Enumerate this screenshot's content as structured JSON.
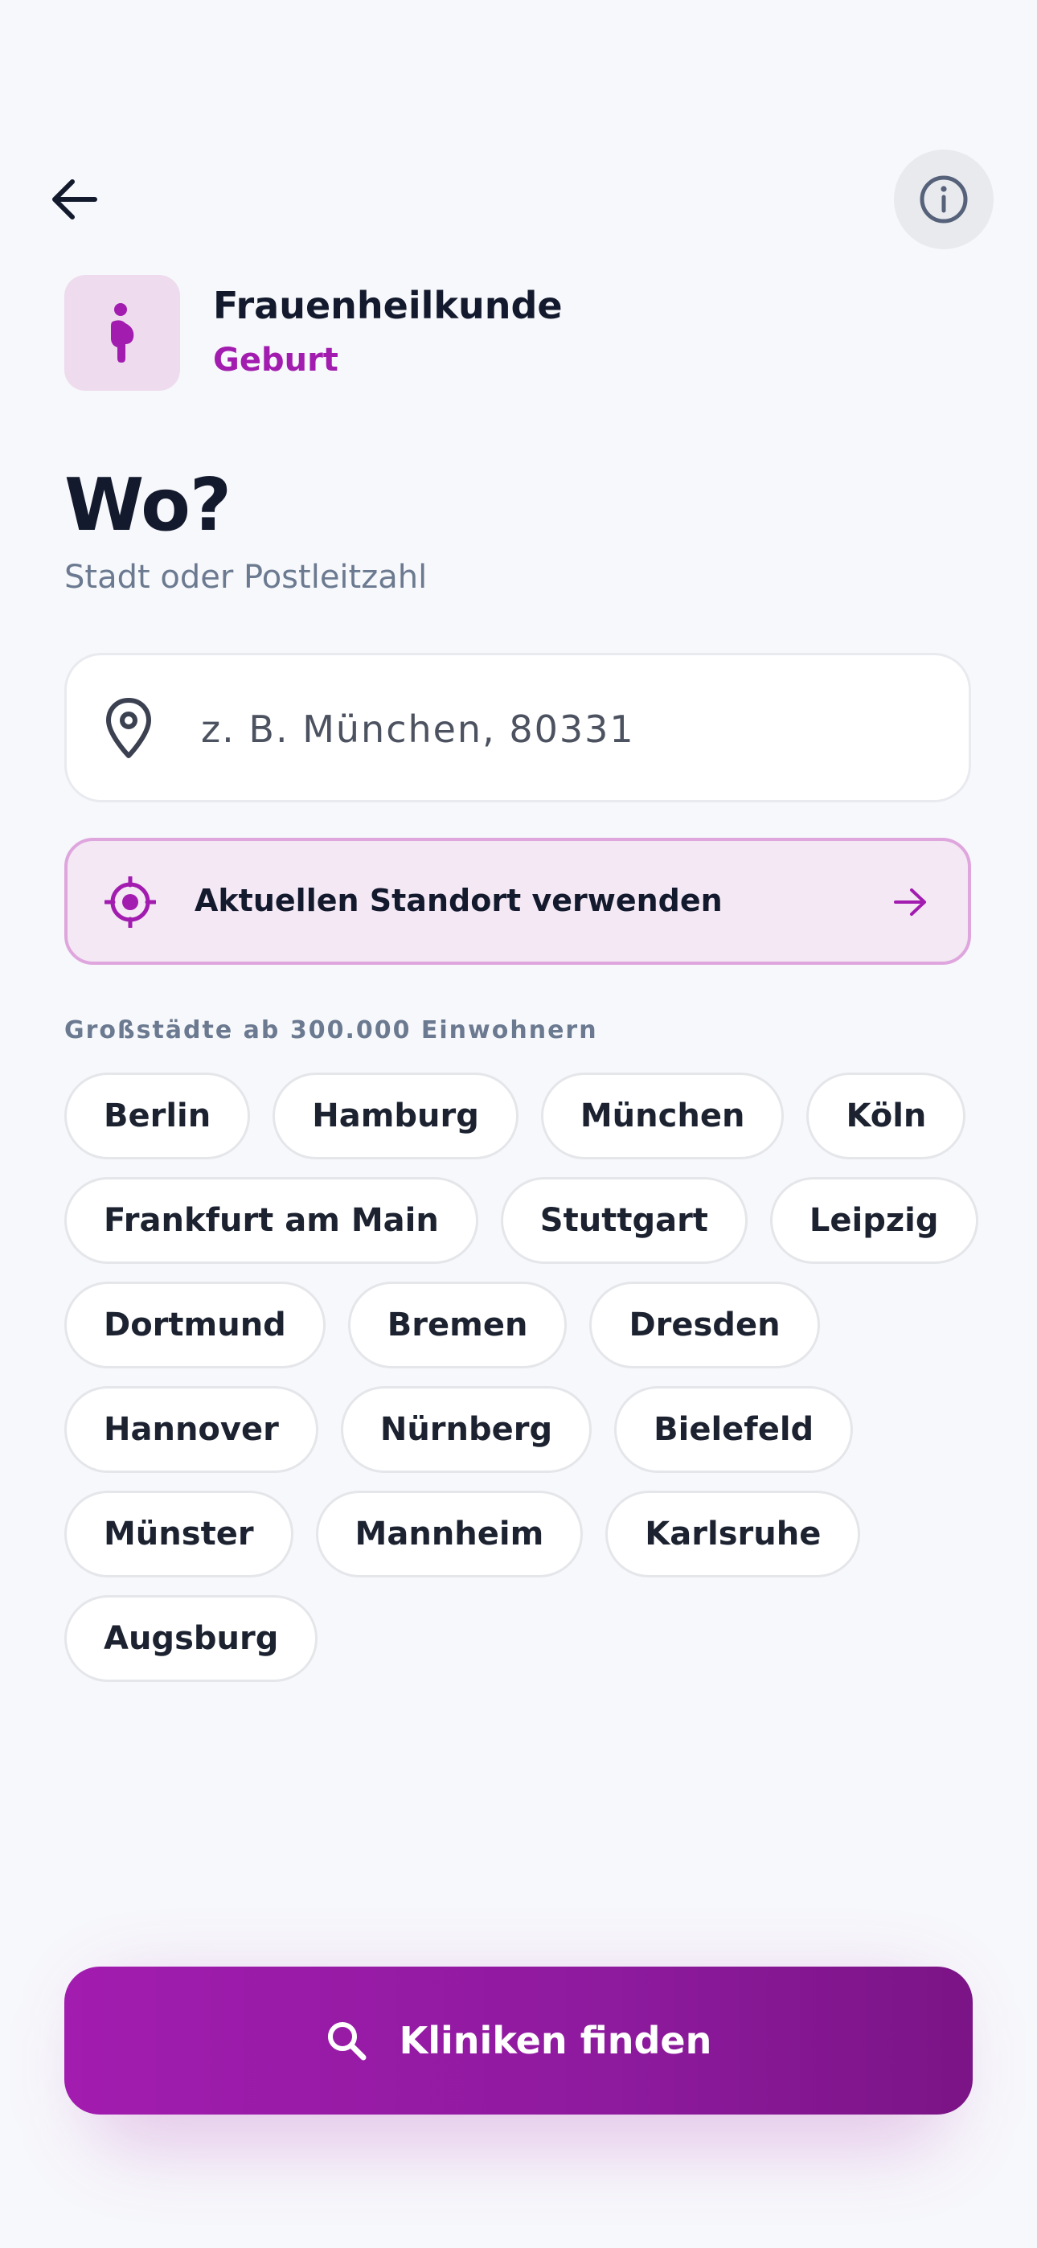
{
  "header": {
    "back_icon": "arrow-left-icon",
    "info_icon": "info-circle-icon"
  },
  "category": {
    "icon": "pregnant-woman-icon",
    "title": "Frauenheilkunde",
    "subtitle": "Geburt"
  },
  "question": {
    "title": "Wo?",
    "subtitle": "Stadt oder Postleitzahl"
  },
  "search": {
    "icon": "map-pin-icon",
    "value": "",
    "placeholder": "z. B. München, 80331"
  },
  "location_button": {
    "icon": "target-icon",
    "label": "Aktuellen Standort verwenden",
    "arrow_icon": "arrow-right-icon"
  },
  "cities": {
    "label": "Großstädte ab 300.000 Einwohnern",
    "items": [
      "Berlin",
      "Hamburg",
      "München",
      "Köln",
      "Frankfurt am Main",
      "Stuttgart",
      "Leipzig",
      "Dortmund",
      "Bremen",
      "Dresden",
      "Hannover",
      "Nürnberg",
      "Bielefeld",
      "Münster",
      "Mannheim",
      "Karlsruhe",
      "Augsburg"
    ]
  },
  "cta": {
    "icon": "search-icon",
    "label": "Kliniken finden"
  },
  "colors": {
    "accent": "#a21caf",
    "accent_dark": "#7b1486",
    "accent_soft": "#f3e8f4",
    "text": "#141a2e",
    "muted": "#6b7a90",
    "background": "#f7f8fb"
  }
}
